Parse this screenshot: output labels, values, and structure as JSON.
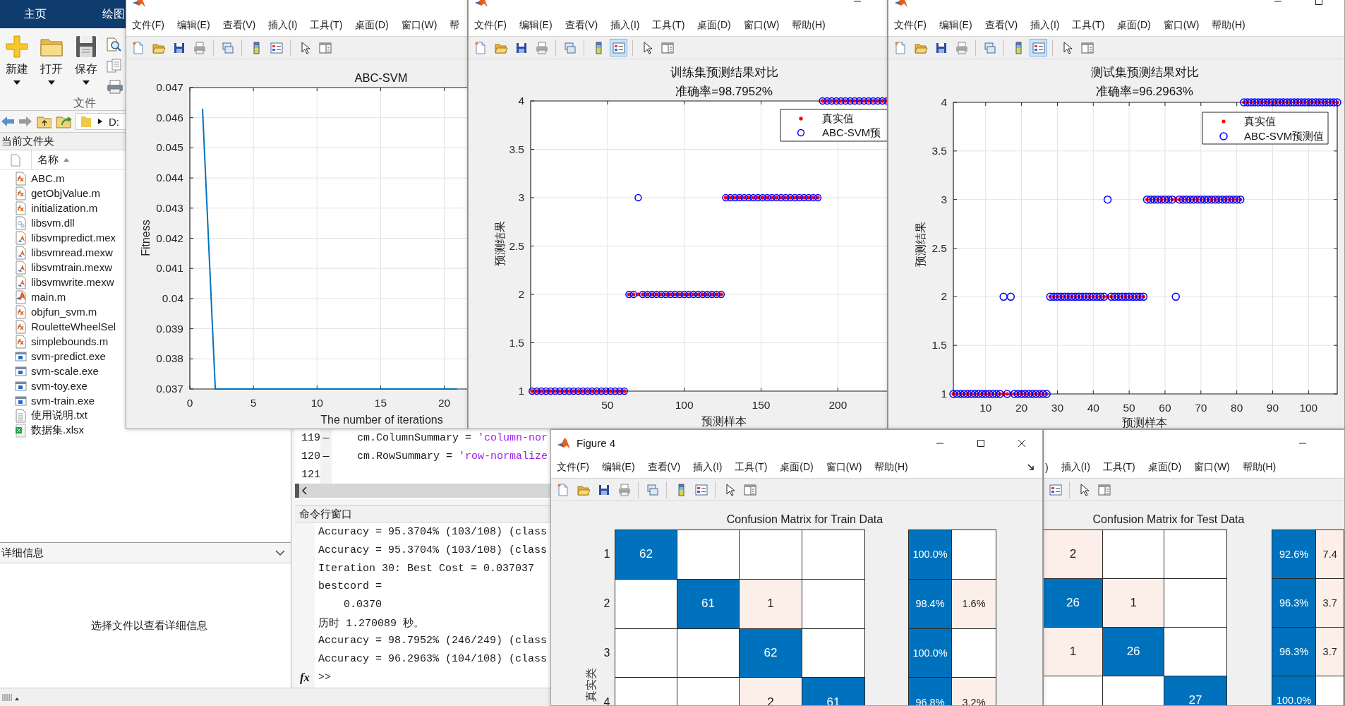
{
  "main_window": {
    "ribbon_tabs": [
      "主页",
      "绘图"
    ],
    "ribbon_buttons": [
      "新建",
      "打开",
      "保存"
    ],
    "ribbon_section": "文件",
    "path": "D:",
    "current_folder": {
      "title": "当前文件夹",
      "column": "名称",
      "files": [
        {
          "name": "ABC.m",
          "kind": "function"
        },
        {
          "name": "getObjValue.m",
          "kind": "function"
        },
        {
          "name": "initialization.m",
          "kind": "function"
        },
        {
          "name": "libsvm.dll",
          "kind": "dll"
        },
        {
          "name": "libsvmpredict.mex",
          "kind": "mex"
        },
        {
          "name": "libsvmread.mexw",
          "kind": "mex"
        },
        {
          "name": "libsvmtrain.mexw",
          "kind": "mex"
        },
        {
          "name": "libsvmwrite.mexw",
          "kind": "mex"
        },
        {
          "name": "main.m",
          "kind": "script"
        },
        {
          "name": "objfun_svm.m",
          "kind": "function"
        },
        {
          "name": "RouletteWheelSel",
          "kind": "function"
        },
        {
          "name": "simplebounds.m",
          "kind": "function"
        },
        {
          "name": "svm-predict.exe",
          "kind": "exe"
        },
        {
          "name": "svm-scale.exe",
          "kind": "exe"
        },
        {
          "name": "svm-toy.exe",
          "kind": "exe"
        },
        {
          "name": "svm-train.exe",
          "kind": "exe"
        },
        {
          "name": "使用说明.txt",
          "kind": "txt"
        },
        {
          "name": "数据集.xlsx",
          "kind": "xlsx"
        }
      ]
    },
    "details": {
      "title": "详细信息",
      "message": "选择文件以查看详细信息"
    },
    "editor": {
      "lines": [
        {
          "number": "119",
          "marker": "—",
          "code": "cm.ColumnSummary = ",
          "string": "'column-nor"
        },
        {
          "number": "120",
          "marker": "—",
          "code": "cm.RowSummary = ",
          "string": "'row-normalize"
        },
        {
          "number": "121"
        }
      ]
    },
    "command_window": {
      "title": "命令行窗口",
      "lines": [
        {
          "text": "Accuracy = 95.3704% (103/108) (class",
          "indented": false
        },
        {
          "text": "Accuracy = 95.3704% (103/108) (class",
          "indented": false
        },
        {
          "text": "Iteration 30: Best Cost = 0.037037",
          "indented": false
        },
        {
          "text": "bestcord =",
          "indented": false
        },
        {
          "text": "0.0370",
          "indented": true
        },
        {
          "text": "历时 1.270089 秒。",
          "indented": false
        },
        {
          "text": "Accuracy = 98.7952% (246/249) (class",
          "indented": false
        },
        {
          "text": "Accuracy = 96.2963% (104/108) (class",
          "indented": false
        }
      ],
      "function_button": "fx",
      "prompt": ">>"
    }
  },
  "figures": [
    {
      "app_icon": true,
      "menu": [
        "文件(F)",
        "编辑(E)",
        "查看(V)",
        "插入(I)",
        "工具(T)",
        "桌面(D)",
        "窗口(W)",
        "帮"
      ],
      "legend_pressed": false,
      "chart_data": {
        "type": "line",
        "title": "ABC-SVM",
        "xlabel": "The number of iterations",
        "ylabel": "Fitness",
        "x": [
          1,
          2,
          3,
          4,
          5,
          6,
          7,
          8,
          9,
          10,
          11,
          12,
          13,
          14,
          15,
          16,
          17,
          18,
          19,
          20,
          21
        ],
        "series": [
          {
            "color": "#0072bd",
            "values": [
              0.0463,
              0.037,
              0.037,
              0.037,
              0.037,
              0.037,
              0.037,
              0.037,
              0.037,
              0.037,
              0.037,
              0.037,
              0.037,
              0.037,
              0.037,
              0.037,
              0.037,
              0.037,
              0.037,
              0.037,
              0.037
            ]
          }
        ],
        "grid": true,
        "xlim": [
          0,
          21.8
        ],
        "ylim": [
          0.037,
          0.047
        ],
        "xticks": [
          0,
          5,
          10,
          15,
          20
        ],
        "yticks": [
          0.037,
          0.038,
          0.039,
          0.04,
          0.041,
          0.042,
          0.043,
          0.044,
          0.045,
          0.046,
          0.047
        ]
      }
    },
    {
      "app_icon": true,
      "window_buttons": [
        {
          "kind": "minimize"
        }
      ],
      "menu": [
        "文件(F)",
        "编辑(E)",
        "查看(V)",
        "插入(I)",
        "工具(T)",
        "桌面(D)",
        "窗口(W)",
        "帮助(H)"
      ],
      "legend_pressed": true,
      "chart_data": {
        "type": "scatter",
        "title": "训练集预测结果对比",
        "subtitle": "准确率=98.7952%",
        "xlabel": "预测样本",
        "ylabel": "预测结果",
        "x": [
          1,
          4,
          7,
          10,
          13,
          16,
          19,
          22,
          25,
          28,
          31,
          34,
          37,
          40,
          43,
          46,
          49,
          52,
          55,
          58,
          61,
          64,
          67,
          70,
          73,
          76,
          79,
          82,
          85,
          88,
          91,
          94,
          97,
          100,
          103,
          106,
          109,
          112,
          115,
          118,
          121,
          124,
          127,
          130,
          133,
          136,
          139,
          142,
          145,
          148,
          151,
          154,
          157,
          160,
          163,
          166,
          169,
          172,
          175,
          178,
          181,
          184,
          187,
          190,
          193,
          196,
          199,
          202,
          205,
          208,
          211,
          214,
          217,
          220,
          223,
          226,
          229,
          232
        ],
        "series": [
          {
            "name": "真实值",
            "color": "#ff0000",
            "values": [
              1,
              1,
              1,
              1,
              1,
              1,
              1,
              1,
              1,
              1,
              1,
              1,
              1,
              1,
              1,
              1,
              1,
              1,
              1,
              1,
              1,
              2,
              2,
              2,
              2,
              2,
              2,
              2,
              2,
              2,
              2,
              2,
              2,
              2,
              2,
              2,
              2,
              2,
              2,
              2,
              2,
              2,
              3,
              3,
              3,
              3,
              3,
              3,
              3,
              3,
              3,
              3,
              3,
              3,
              3,
              3,
              3,
              3,
              3,
              3,
              3,
              3,
              3,
              4,
              4,
              4,
              4,
              4,
              4,
              4,
              4,
              4,
              4,
              4,
              4,
              4,
              4,
              4
            ]
          },
          {
            "name": "ABC-SVM预",
            "color": "#0000ff",
            "values": [
              1,
              1,
              1,
              1,
              1,
              1,
              1,
              1,
              1,
              1,
              1,
              1,
              1,
              1,
              1,
              1,
              1,
              1,
              1,
              1,
              1,
              2,
              2,
              3,
              2,
              2,
              2,
              2,
              2,
              2,
              2,
              2,
              2,
              2,
              2,
              2,
              2,
              2,
              2,
              2,
              2,
              2,
              3,
              3,
              3,
              3,
              3,
              3,
              3,
              3,
              3,
              3,
              3,
              3,
              3,
              3,
              3,
              3,
              3,
              3,
              3,
              3,
              3,
              4,
              4,
              4,
              4,
              4,
              4,
              4,
              4,
              4,
              4,
              4,
              4,
              4,
              4,
              4
            ]
          }
        ],
        "grid": true,
        "legend": true,
        "xlim": [
          0,
          232
        ],
        "ylim": [
          1,
          4
        ],
        "xticks": [
          50,
          100,
          150,
          200
        ],
        "yticks": [
          1,
          1.5,
          2,
          2.5,
          3,
          3.5,
          4
        ]
      }
    },
    {
      "app_icon": true,
      "window_buttons": [
        {
          "kind": "minimize"
        },
        {
          "kind": "maximize"
        }
      ],
      "menu": [
        "文件(F)",
        "编辑(E)",
        "查看(V)",
        "插入(I)",
        "工具(T)",
        "桌面(D)",
        "窗口(W)",
        "帮助(H)"
      ],
      "legend_pressed": true,
      "chart_data": {
        "type": "scatter",
        "title": "测试集预测结果对比",
        "subtitle": "准确率=96.2963%",
        "xlabel": "预测样本",
        "ylabel": "预测结果",
        "x": [
          1,
          2,
          3,
          4,
          5,
          6,
          7,
          8,
          9,
          10,
          11,
          12,
          13,
          14,
          15,
          16,
          17,
          18,
          19,
          20,
          21,
          22,
          23,
          24,
          25,
          26,
          27,
          28,
          29,
          30,
          31,
          32,
          33,
          34,
          35,
          36,
          37,
          38,
          39,
          40,
          41,
          42,
          43,
          44,
          45,
          46,
          47,
          48,
          49,
          50,
          51,
          52,
          53,
          54,
          55,
          56,
          57,
          58,
          59,
          60,
          61,
          62,
          63,
          64,
          65,
          66,
          67,
          68,
          69,
          70,
          71,
          72,
          73,
          74,
          75,
          76,
          77,
          78,
          79,
          80,
          81,
          82,
          83,
          84,
          85,
          86,
          87,
          88,
          89,
          90,
          91,
          92,
          93,
          94,
          95,
          96,
          97,
          98,
          99,
          100,
          101,
          102,
          103,
          104,
          105,
          106,
          107,
          108
        ],
        "series": [
          {
            "name": "真实值",
            "color": "#ff0000",
            "values": [
              1,
              1,
              1,
              1,
              1,
              1,
              1,
              1,
              1,
              1,
              1,
              1,
              1,
              1,
              1,
              1,
              1,
              1,
              1,
              1,
              1,
              1,
              1,
              1,
              1,
              1,
              1,
              2,
              2,
              2,
              2,
              2,
              2,
              2,
              2,
              2,
              2,
              2,
              2,
              2,
              2,
              2,
              2,
              2,
              2,
              2,
              2,
              2,
              2,
              2,
              2,
              2,
              2,
              2,
              3,
              3,
              3,
              3,
              3,
              3,
              3,
              3,
              3,
              3,
              3,
              3,
              3,
              3,
              3,
              3,
              3,
              3,
              3,
              3,
              3,
              3,
              3,
              3,
              3,
              3,
              3,
              4,
              4,
              4,
              4,
              4,
              4,
              4,
              4,
              4,
              4,
              4,
              4,
              4,
              4,
              4,
              4,
              4,
              4,
              4,
              4,
              4,
              4,
              4,
              4,
              4,
              4,
              4
            ]
          },
          {
            "name": "ABC-SVM预测值",
            "color": "#0000ff",
            "values": [
              1,
              1,
              1,
              1,
              1,
              1,
              1,
              1,
              1,
              1,
              1,
              1,
              1,
              1,
              2,
              1,
              2,
              1,
              1,
              1,
              1,
              1,
              1,
              1,
              1,
              1,
              1,
              2,
              2,
              2,
              2,
              2,
              2,
              2,
              2,
              2,
              2,
              2,
              2,
              2,
              2,
              2,
              2,
              3,
              2,
              2,
              2,
              2,
              2,
              2,
              2,
              2,
              2,
              2,
              3,
              3,
              3,
              3,
              3,
              3,
              3,
              3,
              2,
              3,
              3,
              3,
              3,
              3,
              3,
              3,
              3,
              3,
              3,
              3,
              3,
              3,
              3,
              3,
              3,
              3,
              3,
              4,
              4,
              4,
              4,
              4,
              4,
              4,
              4,
              4,
              4,
              4,
              4,
              4,
              4,
              4,
              4,
              4,
              4,
              4,
              4,
              4,
              4,
              4,
              4,
              4,
              4,
              4
            ]
          }
        ],
        "grid": true,
        "legend": true,
        "xlim": [
          1,
          108
        ],
        "ylim": [
          1,
          4
        ],
        "xticks": [
          10,
          20,
          30,
          40,
          50,
          60,
          70,
          80,
          90,
          100
        ],
        "yticks": [
          1,
          1.5,
          2,
          2.5,
          3,
          3.5,
          4
        ]
      }
    },
    {
      "app_icon": true,
      "title": "Figure 4",
      "window_buttons": [
        {
          "kind": "minimize"
        },
        {
          "kind": "maximize"
        },
        {
          "kind": "close"
        }
      ],
      "menu": [
        "文件(F)",
        "编辑(E)",
        "查看(V)",
        "插入(I)",
        "工具(T)",
        "桌面(D)",
        "窗口(W)",
        "帮助(H)"
      ],
      "dock_button": true,
      "legend_pressed": false,
      "confusion_matrix": {
        "title": "Confusion Matrix for Train Data",
        "ylabel": "真实类",
        "row_labels": [
          "1",
          "2",
          "3",
          "4"
        ],
        "cells": [
          [
            {
              "kind": "correct",
              "value": "62"
            },
            {
              "kind": "empty"
            },
            {
              "kind": "empty"
            },
            {
              "kind": "empty"
            }
          ],
          [
            {
              "kind": "empty"
            },
            {
              "kind": "correct",
              "value": "61"
            },
            {
              "kind": "error",
              "value": "1"
            },
            {
              "kind": "empty"
            }
          ],
          [
            {
              "kind": "empty"
            },
            {
              "kind": "empty"
            },
            {
              "kind": "correct",
              "value": "62"
            },
            {
              "kind": "empty"
            }
          ],
          [
            {
              "kind": "empty"
            },
            {
              "kind": "empty"
            },
            {
              "kind": "error",
              "value": "2"
            },
            {
              "kind": "correct",
              "value": "61"
            }
          ]
        ],
        "summary": [
          [
            {
              "kind": "correct",
              "value": "100.0%"
            },
            {
              "kind": "empty"
            }
          ],
          [
            {
              "kind": "correct",
              "value": "98.4%"
            },
            {
              "kind": "error",
              "value": "1.6%"
            }
          ],
          [
            {
              "kind": "correct",
              "value": "100.0%"
            },
            {
              "kind": "empty"
            }
          ],
          [
            {
              "kind": "correct",
              "value": "96.8%"
            },
            {
              "kind": "error",
              "value": "3.2%"
            }
          ]
        ]
      }
    },
    {
      "window_buttons": [
        {
          "kind": "minimize"
        }
      ],
      "menu": [
        ")",
        "插入(I)",
        "工具(T)",
        "桌面(D)",
        "窗口(W)",
        "帮助(H)"
      ],
      "legend_pressed": false,
      "confusion_matrix": {
        "title": "Confusion Matrix for Test Data",
        "cells": [
          [
            {
              "kind": "error",
              "value": "2"
            },
            {
              "kind": "empty"
            },
            {
              "kind": "empty"
            }
          ],
          [
            {
              "kind": "correct",
              "value": "26"
            },
            {
              "kind": "error",
              "value": "1"
            },
            {
              "kind": "empty"
            }
          ],
          [
            {
              "kind": "error",
              "value": "1"
            },
            {
              "kind": "correct",
              "value": "26"
            },
            {
              "kind": "empty"
            }
          ],
          [
            {
              "kind": "empty"
            },
            {
              "kind": "empty"
            },
            {
              "kind": "correct",
              "value": "27"
            }
          ]
        ],
        "summary": [
          [
            {
              "kind": "correct",
              "value": "92.6%"
            },
            {
              "kind": "error",
              "value": "7.4"
            }
          ],
          [
            {
              "kind": "correct",
              "value": "96.3%"
            },
            {
              "kind": "error",
              "value": "3.7"
            }
          ],
          [
            {
              "kind": "correct",
              "value": "96.3%"
            },
            {
              "kind": "error",
              "value": "3.7"
            }
          ],
          [
            {
              "kind": "correct",
              "value": "100.0%"
            },
            {
              "kind": "empty"
            }
          ]
        ]
      }
    }
  ]
}
